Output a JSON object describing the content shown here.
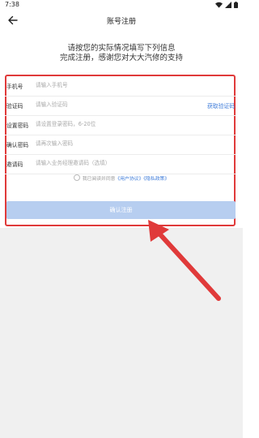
{
  "status_bar": {
    "time": "7:38"
  },
  "header": {
    "title": "账号注册"
  },
  "intro": {
    "line1": "请按您的实际情况填写下列信息",
    "line2": "完成注册，感谢您对大大汽修的支持"
  },
  "form": {
    "phone": {
      "label": "手机号",
      "placeholder": "请输入手机号"
    },
    "code": {
      "label": "验证码",
      "placeholder": "请输入验证码",
      "action": "获取验证码"
    },
    "password": {
      "label": "设置密码",
      "placeholder": "请设置登录密码，6-20位"
    },
    "confirm": {
      "label": "确认密码",
      "placeholder": "请再次输入密码"
    },
    "invite": {
      "label": "邀请码",
      "placeholder": "请输入业务经理邀请码（选填）"
    }
  },
  "agreement": {
    "prefix": "我已阅读并同意",
    "user_agreement": "《用户协议》",
    "privacy_policy": "《隐私政策》"
  },
  "submit": {
    "label": "确认注册"
  },
  "colors": {
    "highlight": "#e03a3a",
    "link": "#3d7bd9",
    "button": "#b7cef0"
  }
}
